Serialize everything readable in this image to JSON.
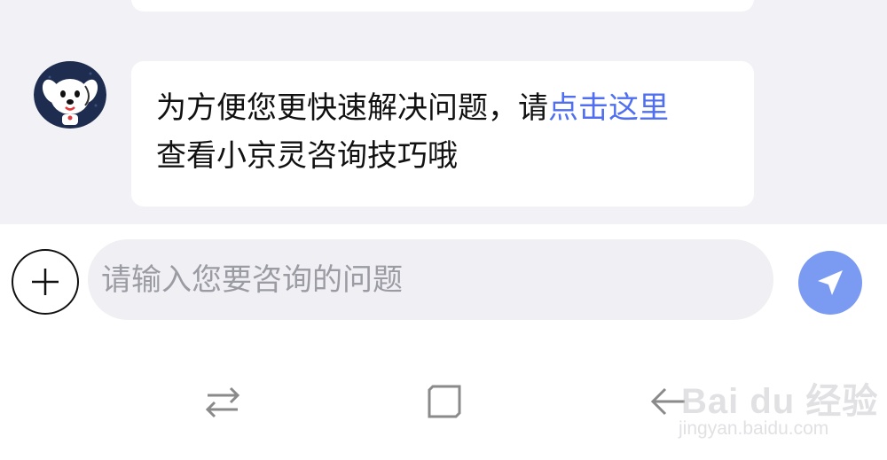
{
  "chat": {
    "message": {
      "text_before": "为方便您更快速解决问题，请",
      "link_text": "点击这里",
      "text_after": "查看小京灵咨询技巧哦"
    }
  },
  "input_bar": {
    "placeholder": "请输入您要咨询的问题"
  },
  "watermark": {
    "brand": "Bai du 经验",
    "url": "jingyan.baidu.com"
  },
  "icons": {
    "avatar": "robot-dog-avatar",
    "add": "plus-icon",
    "send": "send-arrow-icon",
    "nav_switch": "switch-icon",
    "nav_home": "home-square-icon",
    "nav_back": "back-arrow-icon"
  },
  "colors": {
    "link": "#4f6ff0",
    "send_button": "#7b9bf3",
    "chat_background": "#f2f2f6",
    "input_background": "#f0f0f4"
  }
}
